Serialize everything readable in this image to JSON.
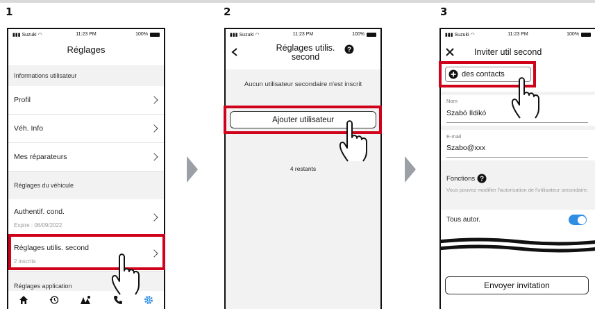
{
  "steps": [
    "1",
    "2",
    "3"
  ],
  "status": {
    "carrier": "Suzuki",
    "time": "11:23 PM",
    "battery": "100%"
  },
  "screen1": {
    "title": "Réglages",
    "sections": {
      "user_info": "Informations utilisateur",
      "vehicle": "Réglages du véhicule",
      "app": "Réglages application"
    },
    "items": {
      "profile": "Profil",
      "veh_info": "Véh. Info",
      "repairers": "Mes réparateurs",
      "auth": "Authentif. cond.",
      "auth_sub": "Expire : 06/09/2022",
      "second_user": "Réglages utilis. second",
      "second_user_sub": "2 inscrits"
    },
    "tabbar": [
      "home-icon",
      "history-icon",
      "map-icon",
      "phone-icon",
      "gear-icon"
    ]
  },
  "screen2": {
    "title": "Réglages utilis.\nsecond",
    "empty_msg": "Aucun utilisateur secondaire n'est inscrit",
    "add_button": "Ajouter utilisateur",
    "remaining": "4 restants"
  },
  "screen3": {
    "title": "Inviter util second",
    "contacts_button": "des contacts",
    "name_label": "Nom",
    "name_value": "Szabó Ildikó",
    "email_label": "E-mail",
    "email_value": "Szabo@xxx",
    "functions_label": "Fonctions",
    "functions_desc": "Vous pouvez modifier l'autorisation de l'utilisateur secondaire.",
    "all_perms": "Tous autor.",
    "all_perms_on": true,
    "send_button": "Envoyer invitation"
  },
  "colors": {
    "highlight": "#d0021b",
    "accent": "#2f8de4",
    "arrow": "#9aa0a6"
  }
}
